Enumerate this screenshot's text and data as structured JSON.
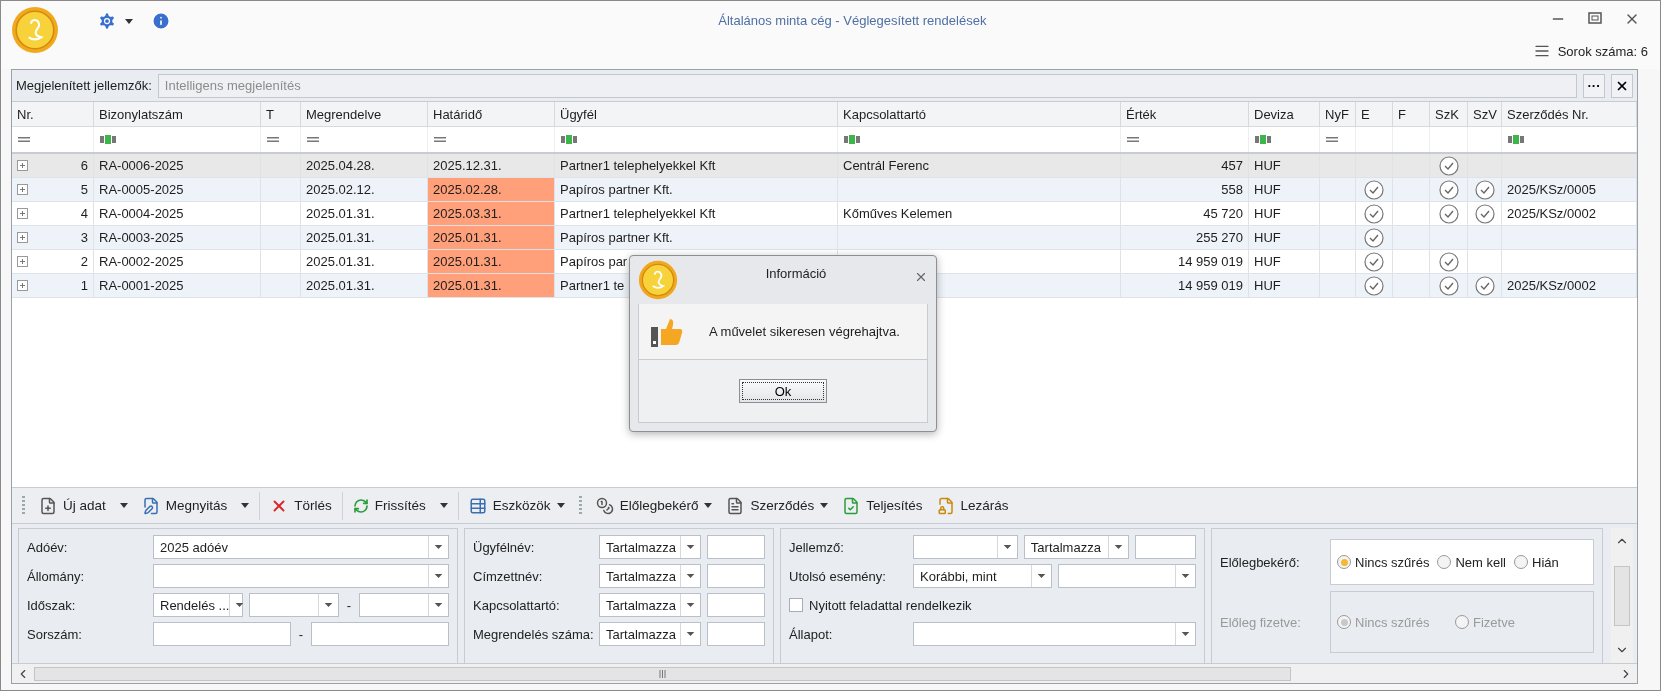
{
  "window": {
    "title": "Általános minta cég - Véglegesített rendelések",
    "row_count": "Sorok száma: 6"
  },
  "display_bar": {
    "label": "Megjelenített jellemzők:",
    "placeholder": "Intelligens megjelenítés",
    "more_button": "···"
  },
  "table": {
    "columns": [
      {
        "label": "Nr.",
        "kind": "equals"
      },
      {
        "label": "Bizonylatszám",
        "kind": "text"
      },
      {
        "label": "T",
        "kind": "equals"
      },
      {
        "label": "Megrendelve",
        "kind": "equals"
      },
      {
        "label": "Határidő",
        "kind": "equals"
      },
      {
        "label": "Ügyfél",
        "kind": "text"
      },
      {
        "label": "Kapcsolattartó",
        "kind": "text"
      },
      {
        "label": "Érték",
        "kind": "equals"
      },
      {
        "label": "Deviza",
        "kind": "text"
      },
      {
        "label": "NyF",
        "kind": "equals"
      },
      {
        "label": "E"
      },
      {
        "label": "F"
      },
      {
        "label": "SzK"
      },
      {
        "label": "SzV"
      },
      {
        "label": "Szerződés Nr.",
        "kind": "text"
      }
    ],
    "rows": [
      {
        "selected": true,
        "nr": "6",
        "number": "RA-0006-2025",
        "ordered": "2025.04.28.",
        "deadline": "2025.12.31.",
        "deadline_highlighted": false,
        "customer": "Partner1 telephelyekkel Kft",
        "contact": "Centrál Ferenc",
        "value": "457",
        "currency": "HUF",
        "e": false,
        "f": false,
        "szk": true,
        "szv": false
      },
      {
        "selected": false,
        "nr": "5",
        "number": "RA-0005-2025",
        "ordered": "2025.02.12.",
        "deadline": "2025.02.28.",
        "deadline_highlighted": true,
        "customer": "Papíros partner Kft.",
        "value": "558",
        "currency": "HUF",
        "e": true,
        "f": false,
        "szk": true,
        "szv": true,
        "contract": "2025/KSz/0005"
      },
      {
        "selected": false,
        "nr": "4",
        "number": "RA-0004-2025",
        "ordered": "2025.01.31.",
        "deadline": "2025.03.31.",
        "deadline_highlighted": true,
        "customer": "Partner1 telephelyekkel Kft",
        "contact": "Kőműves Kelemen",
        "value": "45 720",
        "currency": "HUF",
        "e": true,
        "f": false,
        "szk": true,
        "szv": true,
        "contract": "2025/KSz/0002"
      },
      {
        "selected": false,
        "nr": "3",
        "number": "RA-0003-2025",
        "ordered": "2025.01.31.",
        "deadline": "2025.01.31.",
        "deadline_highlighted": true,
        "customer": "Papíros partner Kft.",
        "value": "255 270",
        "currency": "HUF",
        "e": true,
        "f": false,
        "szk": false,
        "szv": false
      },
      {
        "selected": false,
        "nr": "2",
        "number": "RA-0002-2025",
        "ordered": "2025.01.31.",
        "deadline": "2025.01.31.",
        "deadline_highlighted": true,
        "customer": "Papíros par",
        "value": "14 959 019",
        "currency": "HUF",
        "e": true,
        "f": false,
        "szk": true,
        "szv": false
      },
      {
        "selected": false,
        "nr": "1",
        "number": "RA-0001-2025",
        "ordered": "2025.01.31.",
        "deadline": "2025.01.31.",
        "deadline_highlighted": true,
        "customer": "Partner1 te",
        "value": "14 959 019",
        "currency": "HUF",
        "e": true,
        "f": false,
        "szk": true,
        "szv": true,
        "contract": "2025/KSz/0002"
      }
    ]
  },
  "toolbar": {
    "groups": [
      [
        {
          "label": "Új adat",
          "kind": "split"
        },
        {
          "label": "Megnyitás",
          "kind": "split"
        }
      ],
      [
        {
          "label": "Törlés",
          "kind": "plain"
        }
      ],
      [
        {
          "label": "Frissítés",
          "kind": "split"
        }
      ],
      [
        {
          "label": "Eszközök",
          "kind": "menu"
        }
      ],
      [
        {
          "label": "Előlegbekérő",
          "kind": "menu"
        },
        {
          "label": "Szerződés",
          "kind": "menu"
        },
        {
          "label": "Teljesítés",
          "kind": "plain"
        },
        {
          "label": "Lezárás",
          "kind": "plain"
        }
      ]
    ]
  },
  "filters": [
    {
      "rows": [
        {
          "kind": "controls",
          "label": "Adóév:",
          "controls": [
            {
              "kind": "combo",
              "value": "2025 adóév"
            }
          ]
        },
        {
          "kind": "controls",
          "label": "Állomány:",
          "controls": [
            {
              "kind": "combo"
            }
          ]
        },
        {
          "kind": "controls",
          "label": "Időszak:",
          "controls": [
            {
              "kind": "combo",
              "value": "Rendelés ..."
            },
            {
              "kind": "combo"
            },
            {
              "kind": "dash",
              "text": "-"
            },
            {
              "kind": "combo"
            }
          ]
        },
        {
          "kind": "controls",
          "label": "Sorszám:",
          "controls": [
            {
              "kind": "input"
            },
            {
              "kind": "dash",
              "text": "-"
            },
            {
              "kind": "input"
            }
          ]
        }
      ]
    },
    {
      "rows": [
        {
          "kind": "controls",
          "label": "Ügyfélnév:",
          "controls": [
            {
              "kind": "combo",
              "value": "Tartalmazza"
            },
            {
              "kind": "input"
            }
          ]
        },
        {
          "kind": "controls",
          "label": "Címzettnév:",
          "controls": [
            {
              "kind": "combo",
              "value": "Tartalmazza"
            },
            {
              "kind": "input"
            }
          ]
        },
        {
          "kind": "controls",
          "label": "Kapcsolattartó:",
          "controls": [
            {
              "kind": "combo",
              "value": "Tartalmazza"
            },
            {
              "kind": "input"
            }
          ]
        },
        {
          "kind": "controls",
          "label": "Megrendelés száma:",
          "controls": [
            {
              "kind": "combo",
              "value": "Tartalmazza"
            },
            {
              "kind": "input"
            }
          ]
        }
      ]
    },
    {
      "rows": [
        {
          "kind": "controls",
          "label": "Jellemző:",
          "controls": [
            {
              "kind": "combo"
            },
            {
              "kind": "combo",
              "value": "Tartalmazza"
            },
            {
              "kind": "input"
            }
          ]
        },
        {
          "kind": "controls",
          "label": "Utolsó esemény:",
          "controls": [
            {
              "kind": "combo",
              "value": "Korábbi, mint"
            },
            {
              "kind": "combo"
            }
          ]
        },
        {
          "kind": "checkbox",
          "label": "Nyitott feladattal rendelkezik",
          "checked": false
        },
        {
          "kind": "controls",
          "label": "Állapot:",
          "controls": [
            {
              "kind": "combo"
            }
          ]
        }
      ]
    },
    {
      "rows": [
        {
          "kind": "radios",
          "label": "Előlegbekérő:",
          "disabled": false,
          "options": [
            {
              "label": "Nincs szűrés",
              "selected": true
            },
            {
              "label": "Nem kell",
              "selected": false
            },
            {
              "label": "Hián",
              "selected": false
            }
          ]
        },
        {
          "kind": "radios",
          "label": "Előleg fizetve:",
          "disabled": true,
          "options": [
            {
              "label": "Nincs szűrés",
              "selected": true
            },
            {
              "label": "Fizetve",
              "selected": false
            }
          ]
        }
      ]
    }
  ],
  "dialog": {
    "title": "Információ",
    "message": "A művelet sikeresen végrehajtva.",
    "button": "Ok"
  }
}
